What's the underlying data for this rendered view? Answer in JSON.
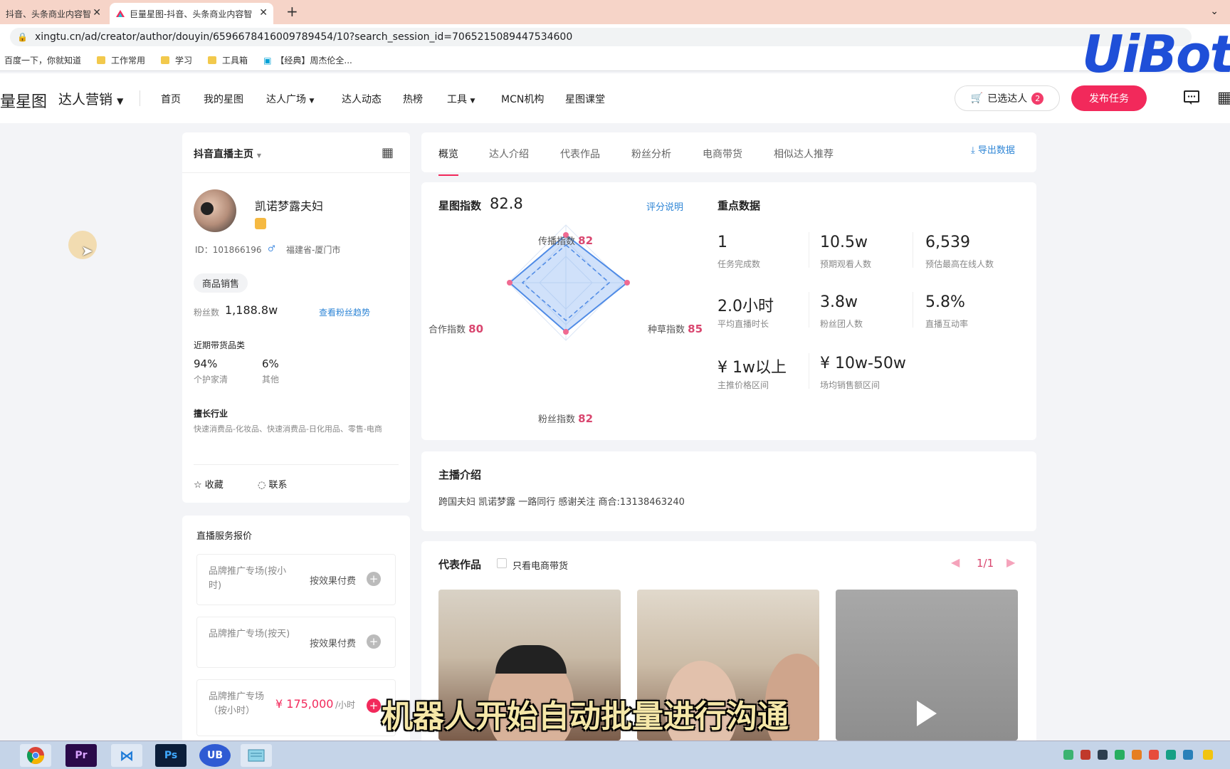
{
  "browser": {
    "tabs": [
      {
        "title": "抖音、头条商业内容智"
      },
      {
        "title": "巨量星图-抖音、头条商业内容智"
      }
    ],
    "url": "xingtu.cn/ad/creator/author/douyin/6596678416009789454/10?search_session_id=7065215089447534600",
    "bookmarks": [
      "百度一下，你就知道",
      "工作常用",
      "学习",
      "工具箱",
      "【经典】周杰伦全..."
    ]
  },
  "watermark": {
    "text": "UiBot"
  },
  "site": {
    "logo_text": "量星图",
    "product": "达人营销",
    "nav": [
      "首页",
      "我的星图",
      "达人广场",
      "达人动态",
      "热榜",
      "工具",
      "MCN机构",
      "星图课堂"
    ],
    "cart_label": "已选达人",
    "cart_count": "2",
    "publish_label": "发布任务"
  },
  "profile": {
    "page_selector": "抖音直播主页",
    "name": "凯诺梦露夫妇",
    "id_text": "ID：101866196",
    "location": "福建省-厦门市",
    "tag": "商品销售",
    "fans_label": "粉丝数",
    "fans_value": "1,188.8w",
    "fans_trend_link": "查看粉丝趋势",
    "recent_category_title": "近期带货品类",
    "categories": [
      {
        "pct": "94%",
        "name": "个护家清"
      },
      {
        "pct": "6%",
        "name": "其他"
      }
    ],
    "industry_title": "擅长行业",
    "industry_text": "快速消费品-化妆品、快速消费品-日化用品、零售-电商",
    "collect_label": "收藏",
    "contact_label": "联系"
  },
  "pricing": {
    "title": "直播服务报价",
    "items": [
      {
        "name": "品牌推广专场(按小时)",
        "price": "按效果付费",
        "unit": ""
      },
      {
        "name": "品牌推广专场(按天)",
        "price": "按效果付费",
        "unit": ""
      },
      {
        "name": "品牌推广专场（按小时）",
        "price": "¥ 175,000",
        "unit": "/小时"
      }
    ]
  },
  "main_tabs": [
    "概览",
    "达人介绍",
    "代表作品",
    "粉丝分析",
    "电商带货",
    "相似达人推荐"
  ],
  "export_label": "导出数据",
  "overview": {
    "index_label": "星图指数",
    "index_value": "82.8",
    "score_link": "评分说明",
    "radar": [
      {
        "label": "传播指数",
        "value": 82
      },
      {
        "label": "种草指数",
        "value": 85
      },
      {
        "label": "粉丝指数",
        "value": 82
      },
      {
        "label": "合作指数",
        "value": 80
      }
    ],
    "key_title": "重点数据",
    "key_data": [
      {
        "value": "1",
        "label": "任务完成数"
      },
      {
        "value": "10.5w",
        "label": "预期观看人数"
      },
      {
        "value": "6,539",
        "label": "预估最高在线人数"
      },
      {
        "value": "2.0小时",
        "label": "平均直播时长"
      },
      {
        "value": "3.8w",
        "label": "粉丝团人数"
      },
      {
        "value": "5.8%",
        "label": "直播互动率"
      },
      {
        "value": "¥ 1w以上",
        "label": "主推价格区间"
      },
      {
        "value": "¥ 10w-50w",
        "label": "场均销售额区间"
      }
    ]
  },
  "intro": {
    "title": "主播介绍",
    "text": "跨国夫妇 凯诺梦露 一路同行 感谢关注 商合:13138463240"
  },
  "works": {
    "title": "代表作品",
    "filter_label": "只看电商带货",
    "pager": "1/1"
  },
  "subtitle": "机器人开始自动批量进行沟通",
  "taskbar": [
    "chrome",
    "Pr",
    "vscode",
    "Ps",
    "UB",
    "notepad"
  ]
}
